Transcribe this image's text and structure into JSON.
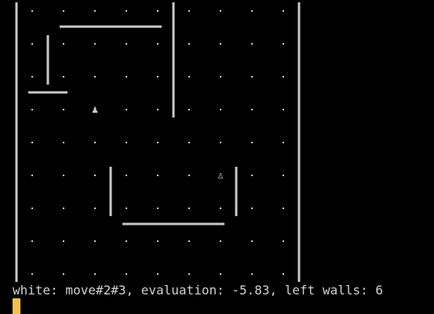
{
  "status": {
    "line": "white: move#2#3, evaluation: -5.83, left walls: 6"
  },
  "board": {
    "columns": 9,
    "rows": 9,
    "dot_glyph": ".",
    "pawns": [
      {
        "name": "black-pawn",
        "glyph": "♟",
        "col": 2,
        "row": 3
      },
      {
        "name": "white-pawn",
        "glyph": "♙",
        "col": 6,
        "row": 5
      }
    ]
  },
  "colors": {
    "background": "#000000",
    "foreground": "#d0d0d0",
    "wall": "#c9c9c9",
    "cursor": "#f5c04a"
  }
}
